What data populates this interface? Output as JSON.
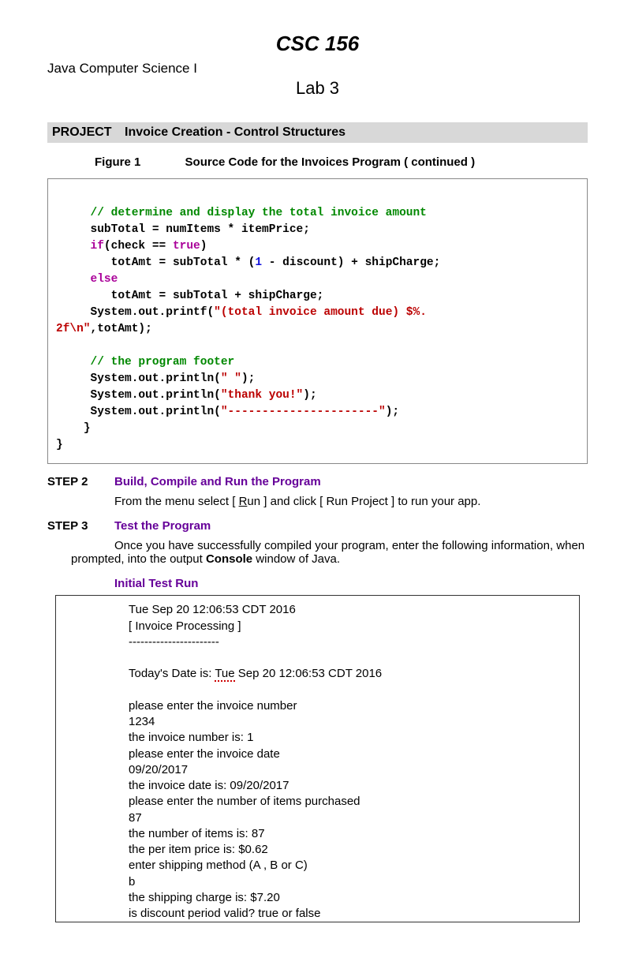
{
  "header": {
    "course_code": "CSC 156",
    "course_name": "Java Computer Science I",
    "lab_title": "Lab 3"
  },
  "project": {
    "label": "PROJECT",
    "title": "Invoice Creation - Control Structures"
  },
  "figure": {
    "label": "Figure 1",
    "caption": "Source Code for the Invoices Program ( continued )"
  },
  "code": {
    "comment1": "// determine and display the total invoice amount",
    "line1a": "     subTotal = numItems * itemPrice;",
    "line2_if": "if",
    "line2_rest": "(check == ",
    "line2_true": "true",
    "line2_end": ")",
    "line3a": "        totAmt = subTotal * (",
    "line3_one": "1",
    "line3b": " - discount) + shipCharge;",
    "line4_else": "else",
    "line5": "        totAmt = subTotal + shipCharge;",
    "line6a": "     System.out.printf(",
    "line6_str": "\"(total invoice amount due) $%.",
    "line6_cont": "2f\\n\"",
    "line6_end": ",totAmt);",
    "comment2": "// the program footer",
    "line7a": "     System.out.println(",
    "line7_str": "\" \"",
    "line7_end": ");",
    "line8a": "     System.out.println(",
    "line8_str": "\"thank you!\"",
    "line8_end": ");",
    "line9a": "     System.out.println(",
    "line9_str": "\"----------------------\"",
    "line9_end": ");",
    "line10": "    }",
    "line11": "}"
  },
  "step2": {
    "label": "STEP 2",
    "title": "Build, Compile and Run the Program",
    "body_a": "From the menu select [ ",
    "body_run": "R",
    "body_run2": "un",
    "body_b": " ] and click [ Run Project ] to run your app."
  },
  "step3": {
    "label": "STEP 3",
    "title": "Test the Program",
    "body_a": "Once you have successfully compiled your program, enter the following information, when prompted, into the output ",
    "body_bold": "Console",
    "body_b": " window of Java."
  },
  "testrun": {
    "title": "Initial Test Run",
    "line1": "Tue Sep 20 12:06:53 CDT 2016",
    "line2": "[ Invoice Processing ]",
    "line3": "-----------------------",
    "line4a": "Today's Date is: ",
    "line4_tue": "Tue",
    "line4b": " Sep 20 12:06:53 CDT 2016",
    "line5": "please enter the invoice number",
    "line6": "1234",
    "line7": "the invoice number is: 1",
    "line8": "please enter the invoice date",
    "line9": "09/20/2017",
    "line10": "the invoice date is: 09/20/2017",
    "line11": "please enter the number of items purchased",
    "line12": "87",
    "line13": "the number of items is: 87",
    "line14": "the per item price is: $0.62",
    "line15": "enter shipping method (A , B or C)",
    "line16": "b",
    "line17": "the shipping charge is: $7.20",
    "line18": "is discount period valid? true or false"
  }
}
